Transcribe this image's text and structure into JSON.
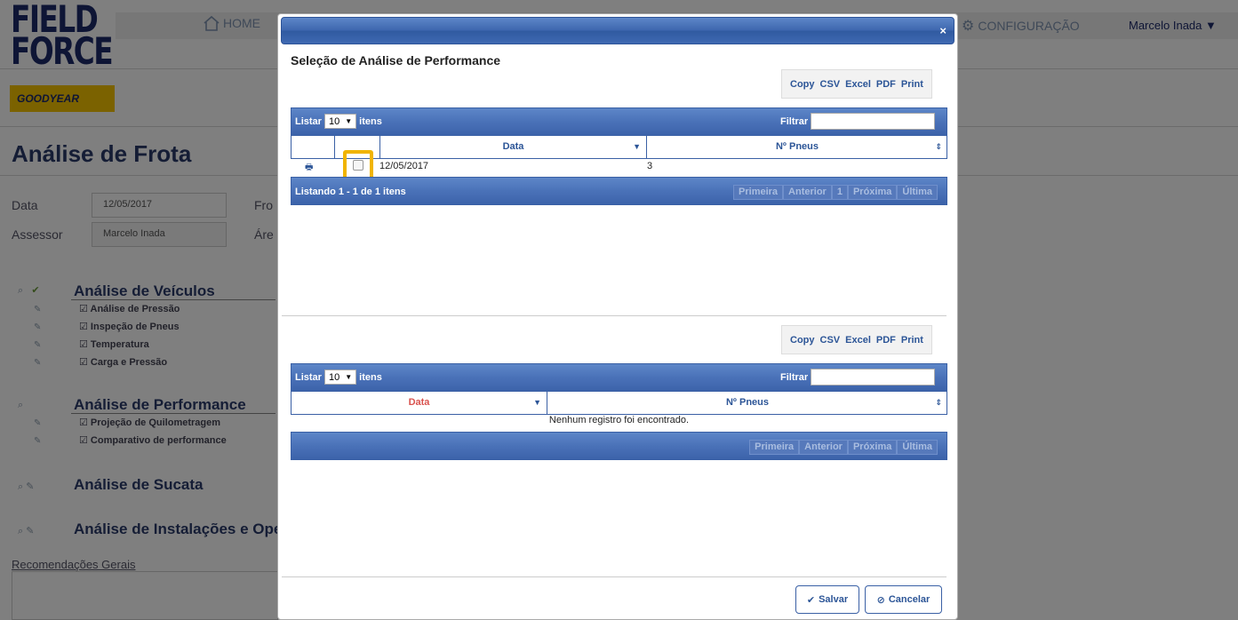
{
  "app": {
    "logo_text": "FIELD FORCE",
    "brand_text": "GOODYEAR",
    "nav": {
      "home": "HOME",
      "config": "CONFIGURAÇÃO",
      "user": "Marcelo Inada"
    }
  },
  "page": {
    "title": "Análise de Frota",
    "fields": {
      "data_label": "Data",
      "data_value": "12/05/2017",
      "fro_label": "Fro",
      "assessor_label": "Assessor",
      "assessor_value": "Marcelo Inada",
      "area_label": "Áre"
    },
    "sections": [
      {
        "title": "Análise de Veículos",
        "items": [
          "Análise de Pressão",
          "Inspeção de Pneus",
          "Temperatura",
          "Carga e Pressão"
        ]
      },
      {
        "title": "Análise de Performance",
        "items": [
          "Projeção de Quilometragem",
          "Comparativo de performance"
        ]
      },
      {
        "title": "Análise de Sucata",
        "items": []
      },
      {
        "title": "Análise de Instalações e Ope",
        "items": []
      }
    ],
    "recommendations_label": "Recomendações Gerais"
  },
  "modal": {
    "close": "×",
    "title": "Seleção de Análise de Performance",
    "export_buttons": [
      "Copy",
      "CSV",
      "Excel",
      "PDF",
      "Print"
    ],
    "table1": {
      "listar": "Listar",
      "page_size": "10",
      "itens": "itens",
      "filtrar": "Filtrar",
      "columns": [
        "Data",
        "Nº Pneus"
      ],
      "rows": [
        {
          "data": "12/05/2017",
          "pneus": "3"
        }
      ],
      "info": "Listando 1 - 1 de 1 itens",
      "pager": [
        "Primeira",
        "Anterior",
        "1",
        "Próxima",
        "Última"
      ]
    },
    "table2": {
      "listar": "Listar",
      "page_size": "10",
      "itens": "itens",
      "filtrar": "Filtrar",
      "columns": [
        "Data",
        "Nº Pneus"
      ],
      "empty": "Nenhum registro foi encontrado.",
      "pager": [
        "Primeira",
        "Anterior",
        "Próxima",
        "Última"
      ]
    },
    "save_label": "Salvar",
    "cancel_label": "Cancelar"
  },
  "colors": {
    "accent": "#3d66ae",
    "highlight": "#f0b400",
    "sort_active": "#d9534f"
  }
}
